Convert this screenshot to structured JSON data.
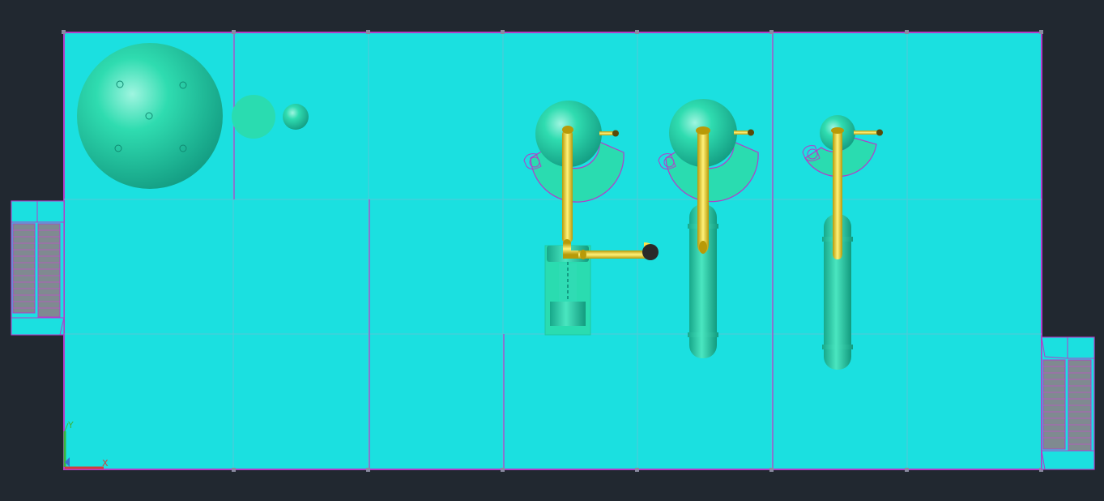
{
  "app": {
    "view": "top",
    "visual_style": "shaded"
  },
  "colors": {
    "background": "#212830",
    "floor_fill": "#1be0e0",
    "grid_line": "#54c8d8",
    "outline": "#b43cc8",
    "equipment": "#24d4a8",
    "equipment_dark": "#14a484",
    "pipe": "#ffe24a",
    "pipe_dark": "#b89a08",
    "ucs_x": "#d23c3c",
    "ucs_y": "#3cb43c"
  },
  "scene": {
    "large_sphere": "storage-sphere",
    "small_spheres": [
      "sphere-tank-1",
      "sphere-tank-2"
    ],
    "vessels": [
      "vessel-1",
      "vessel-2",
      "vessel-3"
    ],
    "stairs": [
      "stair-left",
      "stair-right"
    ]
  },
  "ucs": {
    "x_label": "X",
    "y_label": "Y"
  }
}
